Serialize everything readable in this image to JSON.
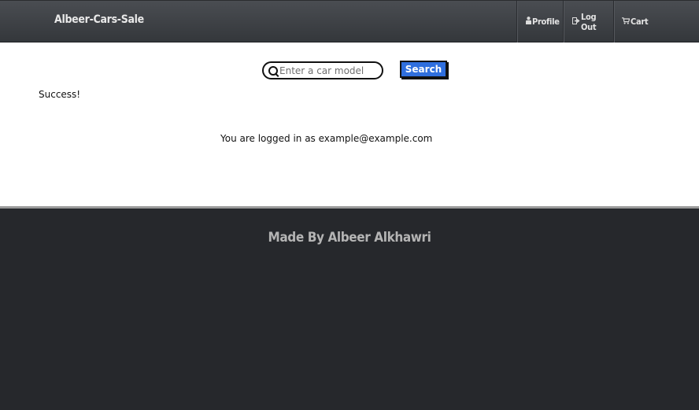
{
  "navbar": {
    "brand": "Albeer-Cars-Sale",
    "items": [
      {
        "label": "Profile",
        "icon": "user-icon"
      },
      {
        "label": "Log Out",
        "icon": "logout-icon"
      },
      {
        "label": "Cart",
        "icon": "cart-icon"
      }
    ]
  },
  "search": {
    "placeholder": "Enter a car model",
    "value": "",
    "button_label": "Search",
    "button_color": "#2f6fde"
  },
  "main": {
    "status_message": "Success!",
    "login_message": "You are logged in as example@example.com"
  },
  "footer": {
    "text": "Made By Albeer Alkhawri",
    "background": "#26282c"
  }
}
